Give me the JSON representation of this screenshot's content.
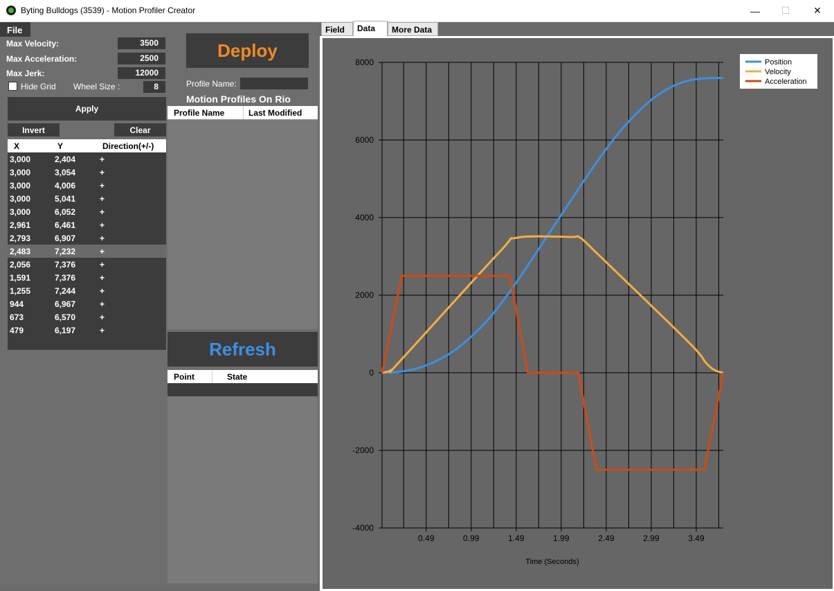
{
  "window": {
    "title": "Byting Bulldogs (3539) - Motion Profiler Creator",
    "minimize": "—",
    "maximize": "☐",
    "close": "✕"
  },
  "menu": {
    "file": "File"
  },
  "settings": {
    "max_velocity_label": "Max Velocity:",
    "max_velocity": "3500",
    "max_acceleration_label": "Max Acceleration:",
    "max_acceleration": "2500",
    "max_jerk_label": "Max Jerk:",
    "max_jerk": "12000",
    "hide_grid_label": "Hide Grid",
    "hide_grid_checked": false,
    "wheel_size_label": "Wheel Size :",
    "wheel_size": "8"
  },
  "buttons": {
    "apply": "Apply",
    "invert": "Invert",
    "clear": "Clear",
    "deploy": "Deploy",
    "refresh": "Refresh"
  },
  "deploy_color": "#f08a24",
  "refresh_color": "#3d8fe0",
  "points_table": {
    "headers": [
      "X",
      "Y",
      "Direction(+/-)"
    ],
    "rows": [
      [
        "3,000",
        "2,404",
        "+"
      ],
      [
        "3,000",
        "3,054",
        "+"
      ],
      [
        "3,000",
        "4,006",
        "+"
      ],
      [
        "3,000",
        "5,041",
        "+"
      ],
      [
        "3,000",
        "6,052",
        "+"
      ],
      [
        "2,961",
        "6,461",
        "+"
      ],
      [
        "2,793",
        "6,907",
        "+"
      ],
      [
        "2,483",
        "7,232",
        "+"
      ],
      [
        "2,056",
        "7,376",
        "+"
      ],
      [
        "1,591",
        "7,376",
        "+"
      ],
      [
        "1,255",
        "7,244",
        "+"
      ],
      [
        "944",
        "6,967",
        "+"
      ],
      [
        "673",
        "6,570",
        "+"
      ],
      [
        "479",
        "6,197",
        "+"
      ]
    ],
    "selected_index": 7
  },
  "profile": {
    "name_label": "Profile Name:",
    "name_value": "",
    "on_rio_title": "Motion Profiles On Rio",
    "headers": [
      "Profile Name",
      "Last Modified"
    ]
  },
  "status_table": {
    "headers": [
      "Point",
      "State"
    ]
  },
  "tabs": [
    {
      "label": "Field"
    },
    {
      "label": "Data",
      "active": true
    },
    {
      "label": "More Data"
    }
  ],
  "chart_data": {
    "type": "line",
    "xlabel": "Time (Seconds)",
    "ylabel": "",
    "xlim": [
      0,
      3.79
    ],
    "ylim": [
      -4000,
      8000
    ],
    "xticks": [
      "0.49",
      "0.99",
      "1.49",
      "1.99",
      "2.49",
      "2.99",
      "3.49"
    ],
    "xtick_values": [
      0.49,
      0.99,
      1.49,
      1.99,
      2.49,
      2.99,
      3.49
    ],
    "yticks": [
      8000,
      6000,
      4000,
      2000,
      0,
      -2000,
      -4000
    ],
    "ytick_labels": [
      "8000",
      "6000",
      "4000",
      "2000",
      "0",
      "-2000",
      "-4000"
    ],
    "grid": true,
    "legend_position": "top-right",
    "series": [
      {
        "name": "Position",
        "color": "#3d8fe0",
        "x": [
          0,
          0.2,
          0.4,
          0.6,
          0.8,
          1.0,
          1.2,
          1.4,
          1.6,
          1.8,
          2.0,
          2.2,
          2.4,
          2.6,
          2.8,
          3.0,
          3.2,
          3.4,
          3.6,
          3.79
        ],
        "y": [
          0,
          25,
          120,
          300,
          570,
          950,
          1430,
          2030,
          2700,
          3400,
          4100,
          4800,
          5480,
          6100,
          6620,
          7050,
          7350,
          7530,
          7590,
          7600
        ]
      },
      {
        "name": "Velocity",
        "color": "#f4ad44",
        "x": [
          0,
          0.1,
          0.2,
          1.3,
          1.5,
          2.1,
          2.2,
          2.4,
          3.4,
          3.6,
          3.7,
          3.79
        ],
        "y": [
          0,
          70,
          300,
          3100,
          3480,
          3500,
          3480,
          3050,
          800,
          250,
          60,
          0
        ]
      },
      {
        "name": "Acceleration",
        "color": "#cf4a16",
        "x": [
          0,
          0.22,
          1.42,
          1.62,
          2.18,
          2.38,
          3.58,
          3.79
        ],
        "y": [
          0,
          2500,
          2500,
          0,
          0,
          -2500,
          -2500,
          0
        ]
      }
    ]
  }
}
